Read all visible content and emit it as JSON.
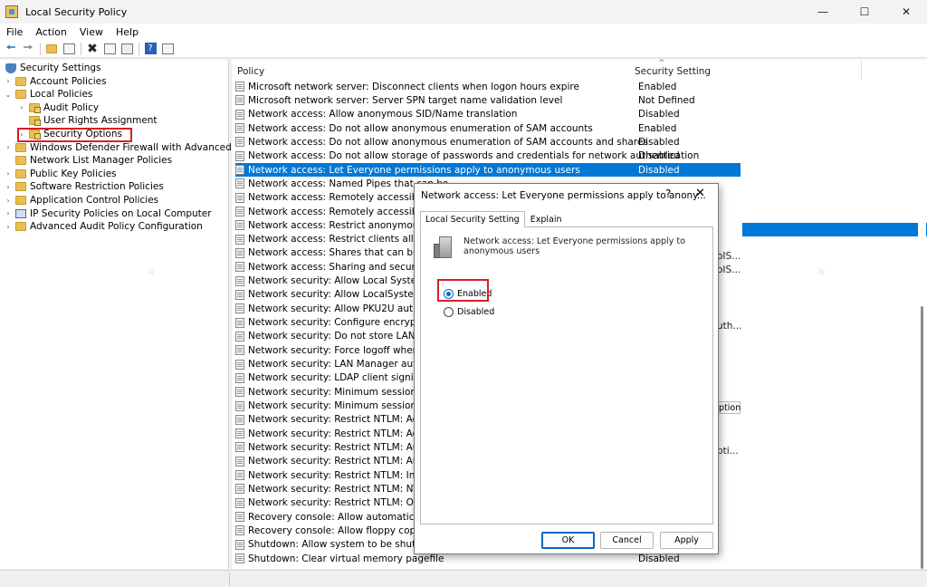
{
  "window": {
    "title": "Local Security Policy",
    "controls": {
      "minimize": "—",
      "maximize": "☐",
      "close": "✕"
    }
  },
  "menu": [
    "File",
    "Action",
    "View",
    "Help"
  ],
  "toolbar": {
    "icons": [
      "back-icon",
      "forward-icon",
      "up-folder-icon",
      "show-hide-tree-icon",
      "delete-icon",
      "properties-icon",
      "export-icon",
      "help-icon"
    ]
  },
  "tree": [
    {
      "label": "Security Settings",
      "expander": "",
      "icon": "shield-icon"
    },
    {
      "label": "Account Policies",
      "expander": "›",
      "icon": "folder-icon"
    },
    {
      "label": "Local Policies",
      "expander": "⌄",
      "icon": "folder-icon"
    },
    {
      "label": "Audit Policy",
      "expander": "›",
      "icon": "folder-lock-icon"
    },
    {
      "label": "User Rights Assignment",
      "expander": "",
      "icon": "folder-lock-icon"
    },
    {
      "label": "Security Options",
      "expander": "›",
      "icon": "folder-lock-icon"
    },
    {
      "label": "Windows Defender Firewall with Advanced Securit",
      "expander": "›",
      "icon": "folder-icon"
    },
    {
      "label": "Network List Manager Policies",
      "expander": "",
      "icon": "folder-icon"
    },
    {
      "label": "Public Key Policies",
      "expander": "›",
      "icon": "folder-icon"
    },
    {
      "label": "Software Restriction Policies",
      "expander": "›",
      "icon": "folder-icon"
    },
    {
      "label": "Application Control Policies",
      "expander": "›",
      "icon": "folder-icon"
    },
    {
      "label": "IP Security Policies on Local Computer",
      "expander": "›",
      "icon": "computer-icon"
    },
    {
      "label": "Advanced Audit Policy Configuration",
      "expander": "›",
      "icon": "folder-icon"
    }
  ],
  "list": {
    "columns": {
      "policy": "Policy",
      "setting": "Security Setting"
    },
    "rows": [
      {
        "policy": "Microsoft network server: Disconnect clients when logon hours expire",
        "setting": "Enabled"
      },
      {
        "policy": "Microsoft network server: Server SPN target name validation level",
        "setting": "Not Defined"
      },
      {
        "policy": "Network access: Allow anonymous SID/Name translation",
        "setting": "Disabled"
      },
      {
        "policy": "Network access: Do not allow anonymous enumeration of SAM accounts",
        "setting": "Enabled"
      },
      {
        "policy": "Network access: Do not allow anonymous enumeration of SAM accounts and shares",
        "setting": "Disabled"
      },
      {
        "policy": "Network access: Do not allow storage of passwords and credentials for network authentication",
        "setting": "Disabled"
      },
      {
        "policy": "Network access: Let Everyone permissions apply to anonymous users",
        "setting": "Disabled"
      },
      {
        "policy": "Network access: Named Pipes that can be",
        "setting": ""
      },
      {
        "policy": "Network access: Remotely accessible regist",
        "setting": ""
      },
      {
        "policy": "Network access: Remotely accessible regist",
        "setting": ""
      },
      {
        "policy": "Network access: Restrict anonymous acce",
        "setting": ""
      },
      {
        "policy": "Network access: Restrict clients allowed to",
        "setting": ""
      },
      {
        "policy": "Network access: Shares that can be accesse",
        "setting": ""
      },
      {
        "policy": "Network access: Sharing and security mod",
        "setting": ""
      },
      {
        "policy": "Network security: Allow Local System to us",
        "setting": ""
      },
      {
        "policy": "Network security: Allow LocalSystem NULL",
        "setting": ""
      },
      {
        "policy": "Network security: Allow PKU2U authenticat",
        "setting": ""
      },
      {
        "policy": "Network security: Configure encryption typ",
        "setting": ""
      },
      {
        "policy": "Network security: Do not store LAN Manag",
        "setting": ""
      },
      {
        "policy": "Network security: Force logoff when logon",
        "setting": ""
      },
      {
        "policy": "Network security: LAN Manager authentica",
        "setting": ""
      },
      {
        "policy": "Network security: LDAP client signing requ",
        "setting": ""
      },
      {
        "policy": "Network security: Minimum session securit",
        "setting": ""
      },
      {
        "policy": "Network security: Minimum session securit",
        "setting": ""
      },
      {
        "policy": "Network security: Restrict NTLM: Add remo",
        "setting": ""
      },
      {
        "policy": "Network security: Restrict NTLM: Add serve",
        "setting": ""
      },
      {
        "policy": "Network security: Restrict NTLM: Audit Inc",
        "setting": ""
      },
      {
        "policy": "Network security: Restrict NTLM: Audit NTL",
        "setting": ""
      },
      {
        "policy": "Network security: Restrict NTLM: Incoming",
        "setting": ""
      },
      {
        "policy": "Network security: Restrict NTLM: NTLM aut",
        "setting": ""
      },
      {
        "policy": "Network security: Restrict NTLM: Outgoing",
        "setting": ""
      },
      {
        "policy": "Recovery console: Allow automatic admini",
        "setting": ""
      },
      {
        "policy": "Recovery console: Allow floppy copy and a",
        "setting": ""
      },
      {
        "policy": "Shutdown: Allow system to be shut down v",
        "setting": ""
      },
      {
        "policy": "Shutdown: Clear virtual memory pagefile",
        "setting": "Disabled"
      }
    ],
    "clipped_fragments": [
      "oIS...",
      "oIS...",
      "uth...",
      "pti...",
      "ption"
    ]
  },
  "dialog": {
    "title": "Network access: Let Everyone permissions apply to anony...",
    "help": "?",
    "close": "✕",
    "tabs": [
      "Local Security Setting",
      "Explain"
    ],
    "description": "Network access: Let Everyone permissions apply to anonymous users",
    "options": [
      "Enabled",
      "Disabled"
    ],
    "selected": "Enabled",
    "buttons": {
      "ok": "OK",
      "cancel": "Cancel",
      "apply": "Apply"
    }
  },
  "colors": {
    "selection": "#0078d7",
    "highlight": "#d81e28",
    "accent": "#0067c0"
  }
}
